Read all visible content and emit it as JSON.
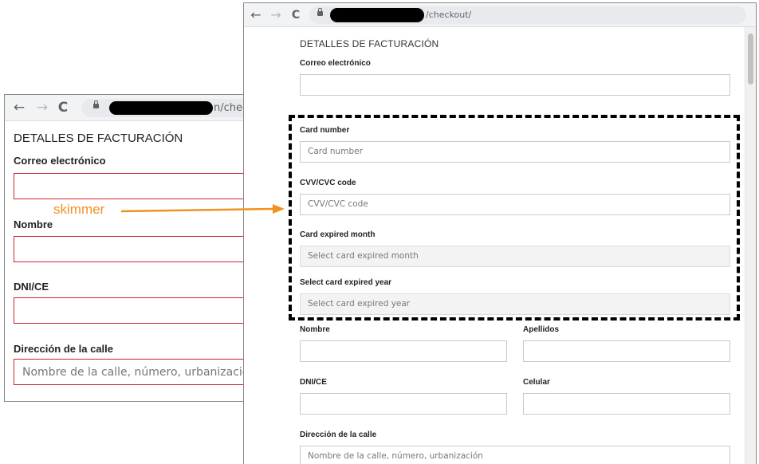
{
  "annotation": {
    "label": "skimmer",
    "color": "#f0921e"
  },
  "left_window": {
    "url_suffix": "n/check",
    "form": {
      "title": "DETALLES DE FACTURACIÓN",
      "email_label": "Correo electrónico",
      "email_value": "",
      "name_label": "Nombre",
      "name_value": "",
      "dni_label": "DNI/CE",
      "dni_value": "",
      "street_label": "Dirección de la calle",
      "street_placeholder": "Nombre de la calle, número, urbanización"
    }
  },
  "right_window": {
    "url_suffix": "/checkout/",
    "form": {
      "title": "DETALLES DE FACTURACIÓN",
      "email_label": "Correo electrónico",
      "email_value": "",
      "card_number_label": "Card number",
      "card_number_placeholder": "Card number",
      "cvv_label": "CVV/CVC code",
      "cvv_placeholder": "CVV/CVC code",
      "exp_month_label": "Card expired month",
      "exp_month_selected": "Select card expired month",
      "exp_year_label": "Select card expired year",
      "exp_year_selected": "Select card expired year",
      "name_label": "Nombre",
      "lastname_label": "Apellidos",
      "dni_label": "DNI/CE",
      "phone_label": "Celular",
      "street_label": "Dirección de la calle",
      "street_placeholder": "Nombre de la calle, número, urbanización"
    }
  },
  "browser": {
    "back_icon": "←",
    "forward_icon": "→",
    "reload_icon": "C"
  }
}
